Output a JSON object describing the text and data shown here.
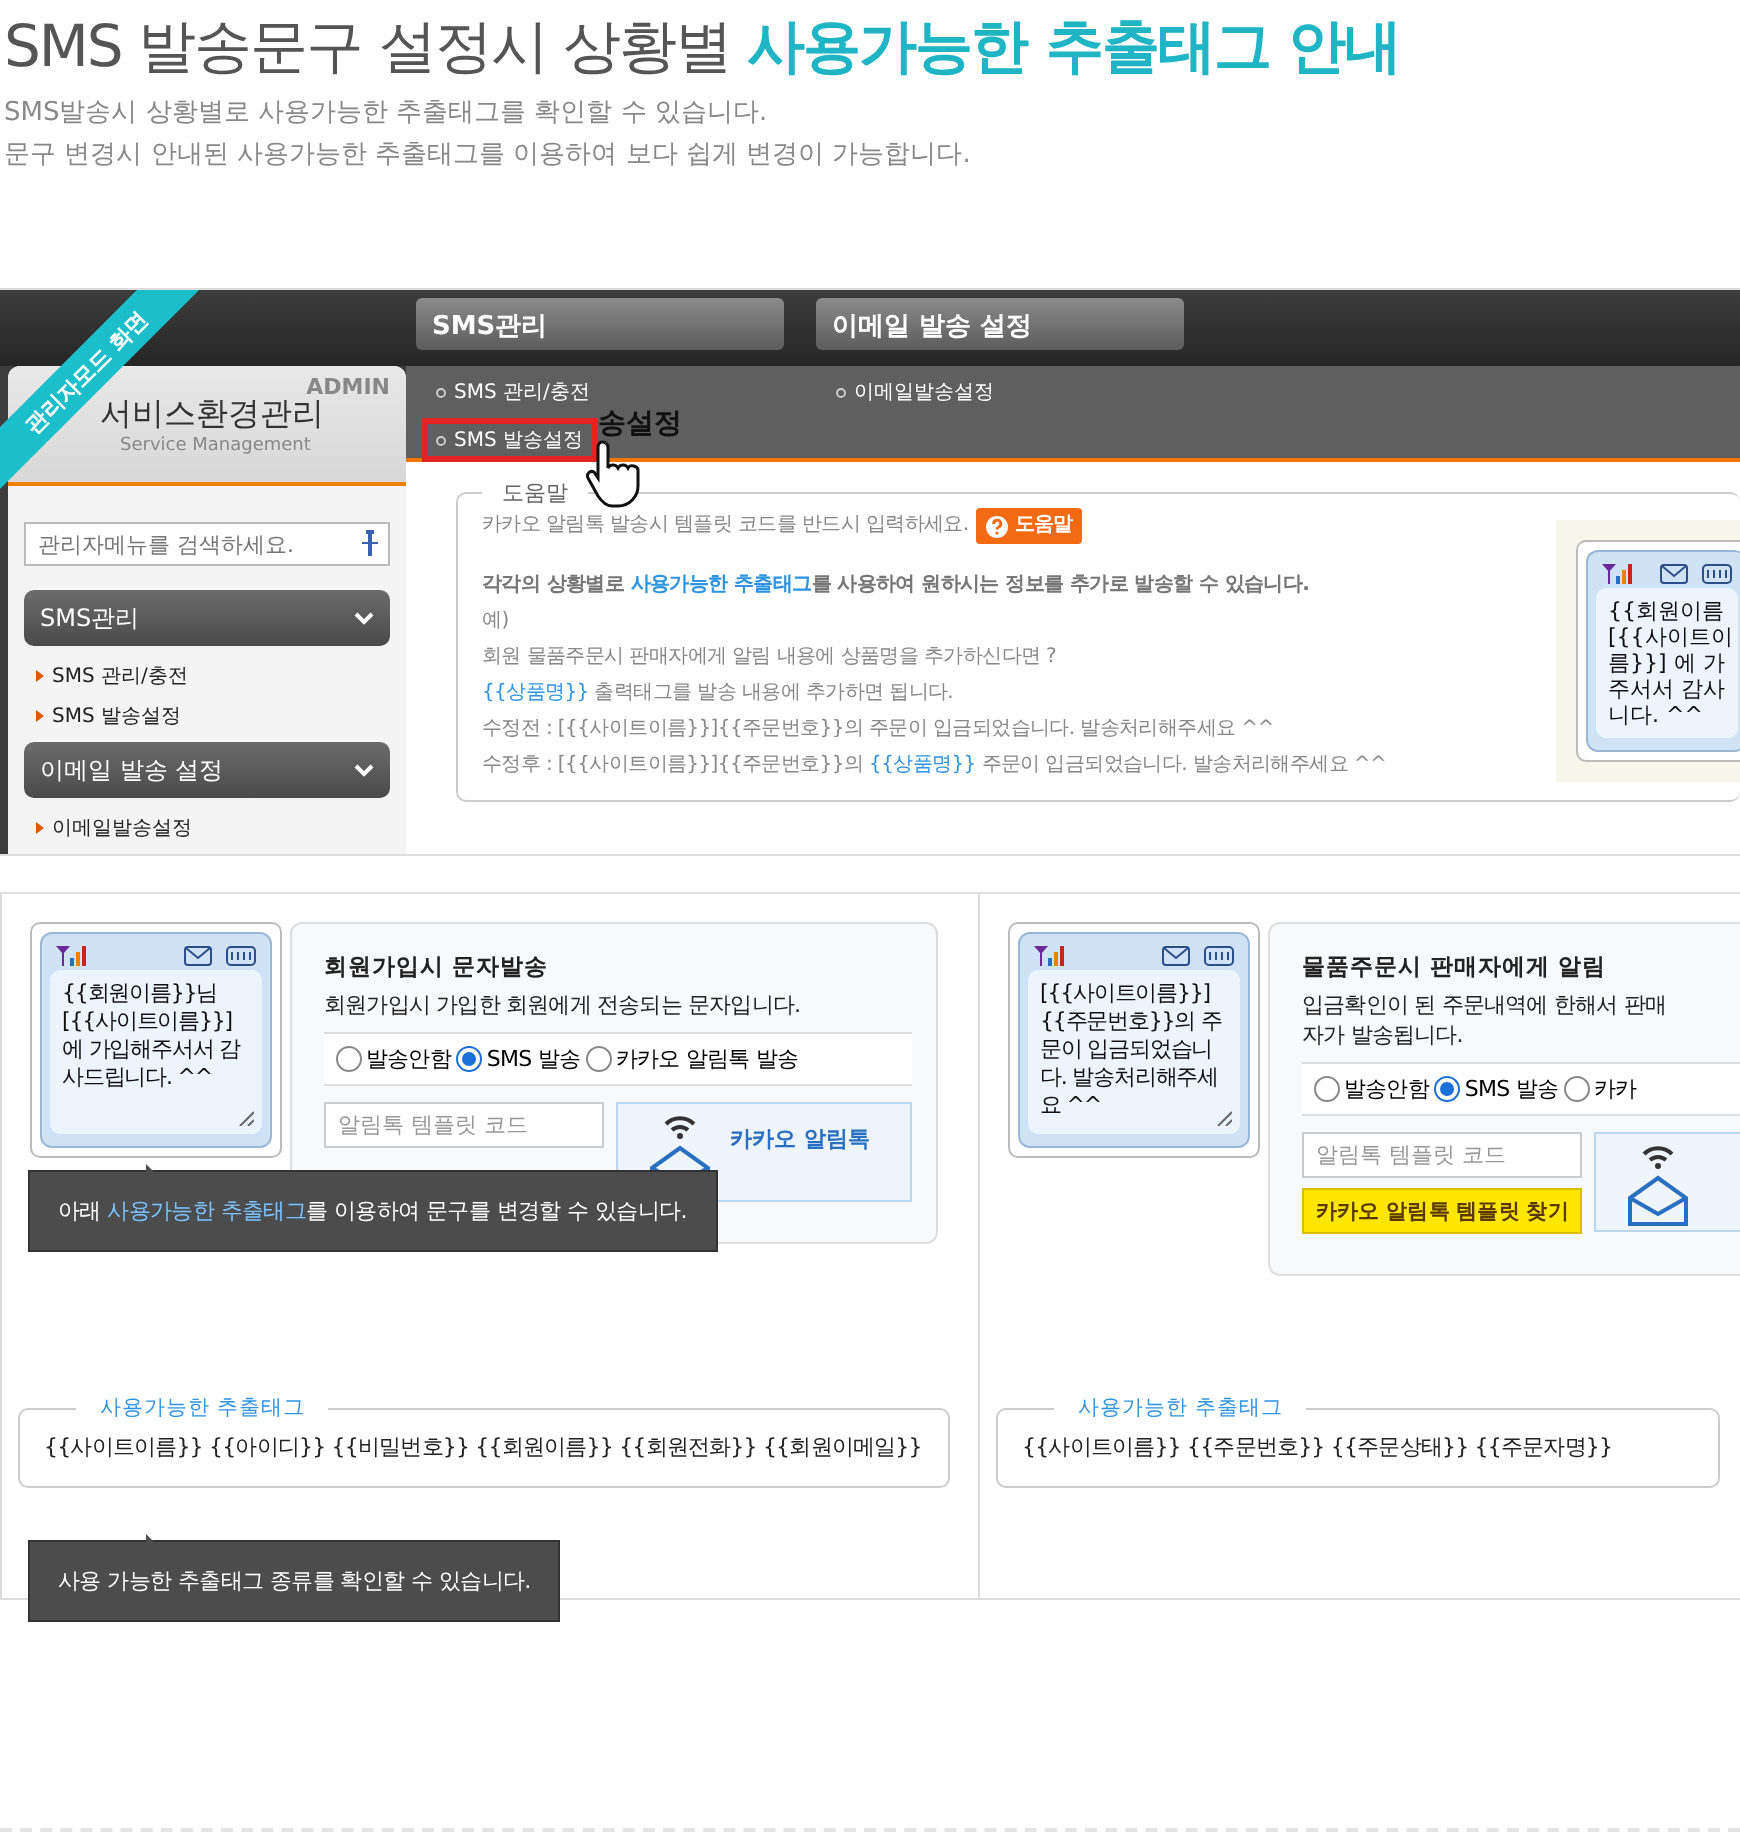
{
  "header": {
    "title": "SMS 발송문구 설정시 상황별",
    "title_highlight": "사용가능한 추출태그 안내",
    "lines": [
      "SMS발송시 상황별로 사용가능한 추출태그를 확인할 수 있습니다.",
      "문구 변경시 안내된 사용가능한 추출태그를 이용하여 보다 쉽게 변경이 가능합니다."
    ]
  },
  "admin": {
    "ribbon": "관리자모드 화면",
    "top_menu": [
      {
        "label": "SMS관리",
        "children": [
          {
            "label": "SMS 관리/충전",
            "selected": false
          },
          {
            "label": "SMS 발송설정",
            "selected": true
          }
        ]
      },
      {
        "label": "이메일 발송 설정",
        "children": [
          {
            "label": "이메일발송설정",
            "selected": false
          }
        ]
      }
    ],
    "page_title": "송설정",
    "sidebar": {
      "badge": "ADMIN",
      "title": "서비스환경관리",
      "subtitle": "Service Management",
      "search_placeholder": "관리자메뉴를 검색하세요.",
      "groups": [
        {
          "label": "SMS관리",
          "children": [
            "SMS 관리/충전",
            "SMS 발송설정"
          ]
        },
        {
          "label": "이메일 발송 설정",
          "children": [
            "이메일발송설정"
          ]
        }
      ]
    },
    "help": {
      "legend": "도움말",
      "intro": "카카오 알림톡 발송시 템플릿 코드를 반드시 입력하세요.",
      "help_button": "도움말",
      "lines": [
        {
          "kind": "bold",
          "segs": [
            {
              "text": "각각의 상황별로 ",
              "highlight": false
            },
            {
              "text": "사용가능한 추출태그",
              "highlight": true
            },
            {
              "text": "를 사용하여 원하시는 정보를 추가로 발송할 수 있습니다.",
              "highlight": false
            }
          ]
        },
        {
          "kind": "plain",
          "segs": [
            {
              "text": "예)",
              "highlight": false
            }
          ]
        },
        {
          "kind": "plain",
          "segs": [
            {
              "text": "회원 물품주문시 판매자에게 알림 내용에 상품명을 추가하신다면 ?",
              "highlight": false
            }
          ]
        },
        {
          "kind": "plain",
          "segs": [
            {
              "text": "{{상품명}}",
              "highlight": true
            },
            {
              "text": " 출력태그를 발송 내용에 추가하면 됩니다.",
              "highlight": false
            }
          ]
        },
        {
          "kind": "plain",
          "segs": [
            {
              "text": "수정전 : [{{사이트이름}}]{{주문번호}}의 주문이 입금되었습니다. 발송처리해주세요 ^^",
              "highlight": false
            }
          ]
        },
        {
          "kind": "plain",
          "segs": [
            {
              "text": "수정후 : [{{사이트이름}}]{{주문번호}}의 ",
              "highlight": false
            },
            {
              "text": "{{상품명}}",
              "highlight": true
            },
            {
              "text": " 주문이 입금되었습니다. 발송처리해주세요 ^^",
              "highlight": false
            }
          ]
        }
      ],
      "phone_lines": [
        "{{회원이름",
        "[{{사이트이",
        "름}}] 에 가",
        "주서서 감사",
        "니다. ^^"
      ]
    }
  },
  "panels": [
    {
      "phone_text": "{{회원이름}}님 [{{사이트이름}}] 에 가입해주서서 감사드립니다. ^^",
      "title": "회원가입시 문자발송",
      "desc": "회원가입시 가입한 회원에게 전송되는 문자입니다.",
      "radios": [
        {
          "label": "발송안함",
          "selected": false
        },
        {
          "label": "SMS 발송",
          "selected": true
        },
        {
          "label": "카카오 알림톡 발송",
          "selected": false
        }
      ],
      "code_placeholder": "알림톡 템플릿 코드",
      "guide": [
        "카카오 알림톡"
      ],
      "tags_legend": "사용가능한 추출태그",
      "tags": "{{사이트이름}} {{아이디}} {{비밀번호}} {{회원이름}} {{회원전화}} {{회원이메일}}",
      "tooltips": [
        {
          "segs": [
            {
              "text": "아래 ",
              "highlight": false
            },
            {
              "text": "사용가능한 추출태그",
              "highlight": true
            },
            {
              "text": "를 이용하여 문구를 변경할 수 있습니다.",
              "highlight": false
            }
          ]
        },
        {
          "segs": [
            {
              "text": "사용 가능한 추출태그 종류를 확인할 수 있습니다.",
              "highlight": false
            }
          ]
        }
      ]
    },
    {
      "phone_text": "[{{사이트이름}}] {{주문번호}}의 주문이 입금되었습니다. 발송처리해주세요 ^^",
      "title": "물품주문시 판매자에게 알림",
      "desc": "입금확인이 된 주문내역에 한해서 판매\n자가 발송됩니다.",
      "radios": [
        {
          "label": "발송안함",
          "selected": false
        },
        {
          "label": "SMS 발송",
          "selected": true
        },
        {
          "label": "카카",
          "selected": false
        }
      ],
      "code_placeholder": "알림톡 템플릿 코드",
      "find_button": "카카오 알림톡 템플릿 찾기",
      "tags_legend": "사용가능한 추출태그",
      "tags": "{{사이트이름}} {{주문번호}} {{주문상태}} {{주문자명}}"
    }
  ]
}
